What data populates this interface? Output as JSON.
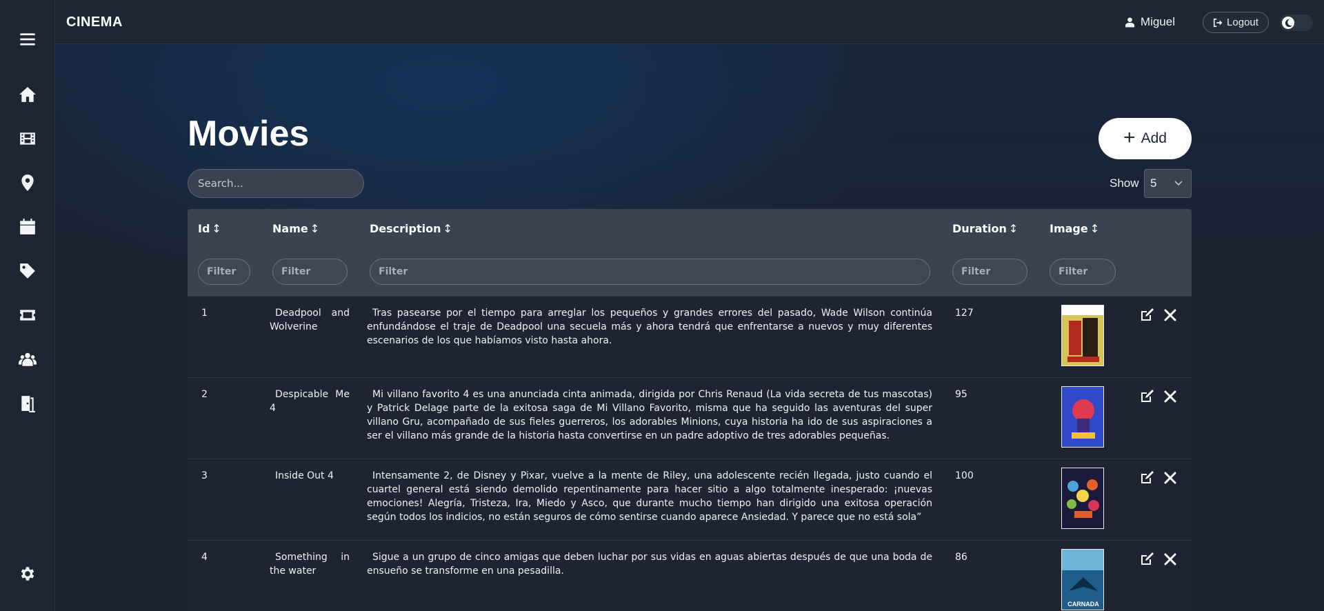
{
  "app": {
    "brand": "CINEMA"
  },
  "topbar": {
    "user_name": "Miguel",
    "logout_label": "Logout"
  },
  "sidebar": {
    "items": [
      {
        "icon": "menu-icon"
      },
      {
        "icon": "home-icon"
      },
      {
        "icon": "film-icon"
      },
      {
        "icon": "location-icon"
      },
      {
        "icon": "calendar-icon"
      },
      {
        "icon": "tag-icon"
      },
      {
        "icon": "ticket-icon"
      },
      {
        "icon": "users-icon"
      },
      {
        "icon": "exit-icon"
      },
      {
        "icon": "gear-icon"
      }
    ]
  },
  "page": {
    "title": "Movies",
    "add_label": "Add",
    "search_placeholder": "Search...",
    "show_label": "Show",
    "show_value": "5"
  },
  "table": {
    "columns": [
      {
        "label": "Id",
        "sort": "↕"
      },
      {
        "label": "Name",
        "sort": "↕"
      },
      {
        "label": "Description",
        "sort": "↕"
      },
      {
        "label": "Duration",
        "sort": "↕"
      },
      {
        "label": "Image",
        "sort": "↕"
      }
    ],
    "filter_placeholder": "Filter",
    "rows": [
      {
        "id": "1",
        "name": "Deadpool and Wolverine",
        "description": "Tras pasearse por el tiempo para arreglar los pequeños y grandes errores del pasado, Wade Wilson continúa enfundándose el traje de Deadpool una secuela más y ahora tendrá que enfrentarse a nuevos y muy diferentes escenarios de los que habíamos visto hasta ahora.",
        "duration": "127",
        "poster_colors": [
          "#d8c35a",
          "#b32a1e",
          "#2a1d16"
        ]
      },
      {
        "id": "2",
        "name": "Despicable Me 4",
        "description": "Mi villano favorito 4 es una anunciada cinta animada, dirigida por Chris Renaud (La vida secreta de tus mascotas) y Patrick Delage parte de la exitosa saga de Mi Villano Favorito, misma que ha seguido las aventuras del super villano Gru, acompañado de sus fieles guerreros, los adorables Minions, cuya historia ha ido de sus aspiraciones a ser el villano más grande de la historia hasta convertirse en un padre adoptivo de tres adorables pequeñas.",
        "duration": "95",
        "poster_colors": [
          "#2f49c9",
          "#e03a52",
          "#f0c531"
        ]
      },
      {
        "id": "3",
        "name": "Inside Out 4",
        "description": "Intensamente 2, de Disney y Pixar, vuelve a la mente de Riley, una adolescente recién llegada, justo cuando el cuartel general está siendo demolido repentinamente para hacer sitio a algo totalmente inesperado: ¡nuevas emociones! Alegría, Tristeza, Ira, Miedo y Asco, que durante mucho tiempo han dirigido una exitosa operación según todos los indicios, no están seguros de cómo sentirse cuando aparece Ansiedad. Y parece que no está sola”",
        "duration": "100",
        "poster_colors": [
          "#1b1a3a",
          "#e35f2b",
          "#4aa4d8"
        ]
      },
      {
        "id": "4",
        "name": "Something in the water",
        "description": "Sigue a un grupo de cinco amigas que deben luchar por sus vidas en aguas abiertas después de que una boda de ensueño se transforme en una pesadilla.",
        "duration": "86",
        "poster_colors": [
          "#6fb3d8",
          "#1f5d8a",
          "#0c2b44"
        ],
        "poster_text": "CARNADA"
      }
    ]
  },
  "colors": {
    "accent": "#ffffff",
    "surface": "#1f2633",
    "header_row": "#3b4252"
  }
}
